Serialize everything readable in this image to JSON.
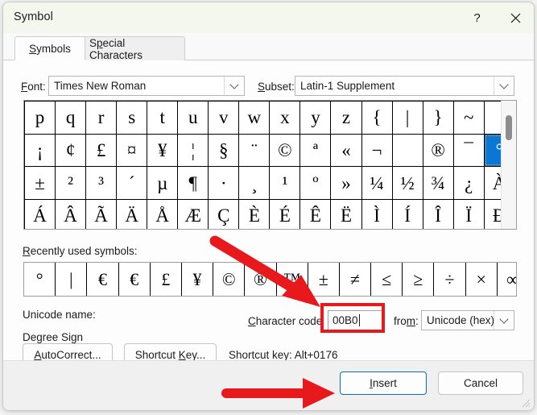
{
  "window": {
    "title": "Symbol",
    "help_icon": "question-mark-icon",
    "close_icon": "close-icon"
  },
  "tabs": [
    {
      "label": "Symbols",
      "accel": "S",
      "active": true
    },
    {
      "label": "Special Characters",
      "accel": "p",
      "active": false
    }
  ],
  "fields": {
    "font_label": "Font:",
    "font_accel": "F",
    "font_value": "Times New Roman",
    "subset_label": "Subset:",
    "subset_accel": "S",
    "subset_value": "Latin-1 Supplement"
  },
  "symbol_grid": {
    "rows": [
      [
        "p",
        "q",
        "r",
        "s",
        "t",
        "u",
        "v",
        "w",
        "x",
        "y",
        "z",
        "{",
        "|",
        "}",
        "~",
        ""
      ],
      [
        "¡",
        "¢",
        "£",
        "¤",
        "¥",
        "¦",
        "§",
        "¨",
        "©",
        "ª",
        "«",
        "¬",
        "­",
        "®",
        "¯",
        "°"
      ],
      [
        "±",
        "²",
        "³",
        "´",
        "µ",
        "¶",
        "·",
        "¸",
        "¹",
        "º",
        "»",
        "¼",
        "½",
        "¾",
        "¿",
        "À"
      ],
      [
        "Á",
        "Â",
        "Ã",
        "Ä",
        "Å",
        "Æ",
        "Ç",
        "È",
        "É",
        "Ê",
        "Ë",
        "Ì",
        "Í",
        "Î",
        "Ï",
        "Ð"
      ]
    ],
    "selected": {
      "row": 1,
      "col": 15,
      "char": "°"
    },
    "scrollbar": "vertical-scrollbar"
  },
  "recent": {
    "label": "Recently used symbols:",
    "accel": "R",
    "symbols": [
      "°",
      "|",
      "€",
      "€",
      "£",
      "¥",
      "©",
      "®",
      "™",
      "±",
      "≠",
      "≤",
      "≥",
      "÷",
      "×",
      "∞"
    ]
  },
  "unicode": {
    "name_label": "Unicode name:",
    "name_value": "Degree Sign",
    "charcode_label": "Character code",
    "charcode_accel": "C",
    "charcode_value": "00B0",
    "from_label": "from:",
    "from_accel": "m",
    "from_value": "Unicode (hex)"
  },
  "buttons": {
    "autocorrect": "AutoCorrect...",
    "autocorrect_accel": "A",
    "shortcut_key": "Shortcut Key...",
    "shortcut_key_accel": "K",
    "shortcut_hint": "Shortcut key: Alt+0176",
    "insert": "Insert",
    "insert_accel": "I",
    "cancel": "Cancel"
  },
  "annotations": {
    "arrow_color": "#e8191c",
    "highlight_box_color": "#e8191c"
  }
}
